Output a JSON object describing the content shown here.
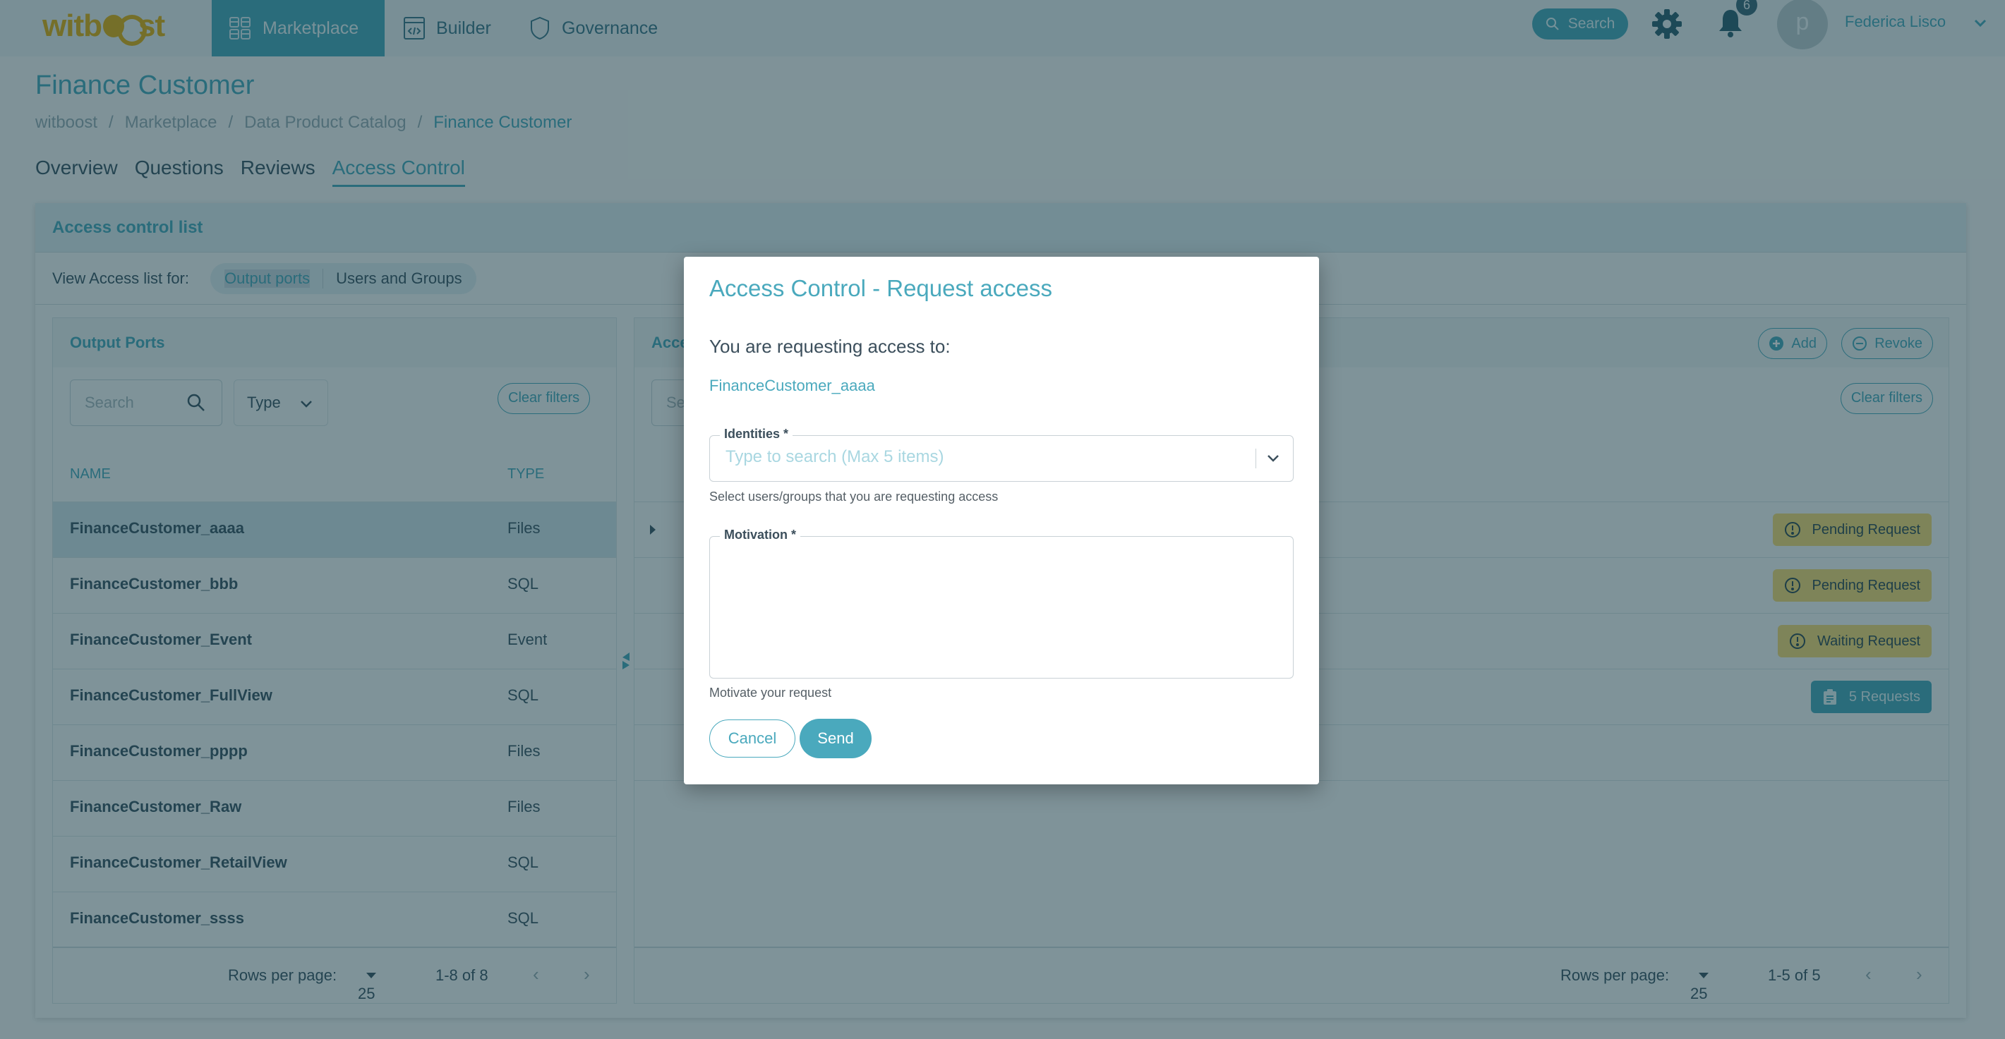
{
  "topbar": {
    "logo": {
      "pre": "witb",
      "post": "st"
    },
    "nav": [
      {
        "label": "Marketplace",
        "icon": "grid-icon",
        "active": true
      },
      {
        "label": "Builder",
        "icon": "code-window-icon",
        "active": false
      },
      {
        "label": "Governance",
        "icon": "shield-icon",
        "active": false
      }
    ],
    "search_label": "Search",
    "notifications_count": "6",
    "avatar_letter": "p",
    "user_name": "Federica Lisco"
  },
  "page": {
    "title": "Finance Customer",
    "breadcrumb": [
      "witboost",
      "Marketplace",
      "Data Product Catalog",
      "Finance Customer"
    ],
    "tabs": [
      {
        "label": "Overview",
        "active": false
      },
      {
        "label": "Questions",
        "active": false
      },
      {
        "label": "Reviews",
        "active": false
      },
      {
        "label": "Access Control",
        "active": true
      }
    ]
  },
  "acl": {
    "title": "Access control list",
    "view_label": "View Access list for:",
    "view_options": [
      "Output ports",
      "Users and Groups"
    ],
    "view_selected": "Output ports",
    "left": {
      "title": "Output Ports",
      "search_placeholder": "Search",
      "type_filter": "Type",
      "clear_filters": "Clear filters",
      "columns": [
        "NAME",
        "TYPE"
      ],
      "rows": [
        {
          "name": "FinanceCustomer_aaaa",
          "type": "Files",
          "selected": true
        },
        {
          "name": "FinanceCustomer_bbb",
          "type": "SQL"
        },
        {
          "name": "FinanceCustomer_Event",
          "type": "Event"
        },
        {
          "name": "FinanceCustomer_FullView",
          "type": "SQL"
        },
        {
          "name": "FinanceCustomer_pppp",
          "type": "Files"
        },
        {
          "name": "FinanceCustomer_Raw",
          "type": "Files"
        },
        {
          "name": "FinanceCustomer_RetailView",
          "type": "SQL"
        },
        {
          "name": "FinanceCustomer_ssss",
          "type": "SQL"
        }
      ],
      "pager": {
        "rows_label": "Rows per page:",
        "rows_value": "25",
        "range": "1-8 of 8"
      }
    },
    "right": {
      "title": "Access",
      "add_label": "Add",
      "revoke_label": "Revoke",
      "search_placeholder": "Search",
      "clear_filters": "Clear filters",
      "rows": [
        {
          "status": "Pending Request",
          "kind": "warn",
          "icon": "alert-circle-icon"
        },
        {
          "status": "Pending Request",
          "kind": "warn",
          "icon": "alert-circle-icon"
        },
        {
          "status": "Waiting Request",
          "kind": "warn",
          "icon": "alert-circle-icon"
        },
        {
          "status": "5 Requests",
          "kind": "info",
          "icon": "clipboard-icon"
        },
        {
          "status": "",
          "kind": ""
        }
      ],
      "pager": {
        "rows_label": "Rows per page:",
        "rows_value": "25",
        "range": "1-5 of 5"
      }
    }
  },
  "modal": {
    "title": "Access Control - Request access",
    "intro": "You are requesting access to:",
    "target": "FinanceCustomer_aaaa",
    "identities": {
      "label": "Identities *",
      "placeholder": "Type to search (Max 5 items)",
      "helper": "Select users/groups that you are requesting access"
    },
    "motivation": {
      "label": "Motivation *",
      "value": "",
      "helper": "Motivate your request"
    },
    "cancel_label": "Cancel",
    "send_label": "Send"
  },
  "colors": {
    "accent": "#3aa2b7",
    "modal_accent": "#4aa9bd",
    "warn": "#f3d76a",
    "logo": "#e0a800"
  }
}
